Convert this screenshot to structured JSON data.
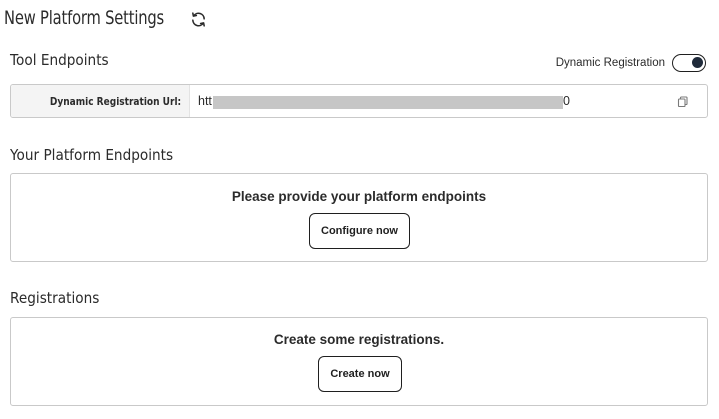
{
  "header": {
    "title": "New Platform Settings",
    "refresh_icon": "refresh-icon"
  },
  "tool_endpoints": {
    "title": "Tool Endpoints",
    "dynamic_registration_label": "Dynamic Registration",
    "dynamic_registration_enabled": true,
    "url_label": "Dynamic Registration Url:",
    "url_visible_prefix": "htt",
    "url_visible_suffix": "0",
    "copy_icon": "copy-icon"
  },
  "platform_endpoints": {
    "title": "Your Platform Endpoints",
    "message": "Please provide your platform endpoints",
    "button_label": "Configure now"
  },
  "registrations": {
    "title": "Registrations",
    "message": "Create some registrations.",
    "button_label": "Create now"
  },
  "colors": {
    "border": "#c9c9c9",
    "label_bg": "#f4f4f4",
    "redaction": "#c6c6c6",
    "toggle_knob": "#1f2a3a"
  }
}
